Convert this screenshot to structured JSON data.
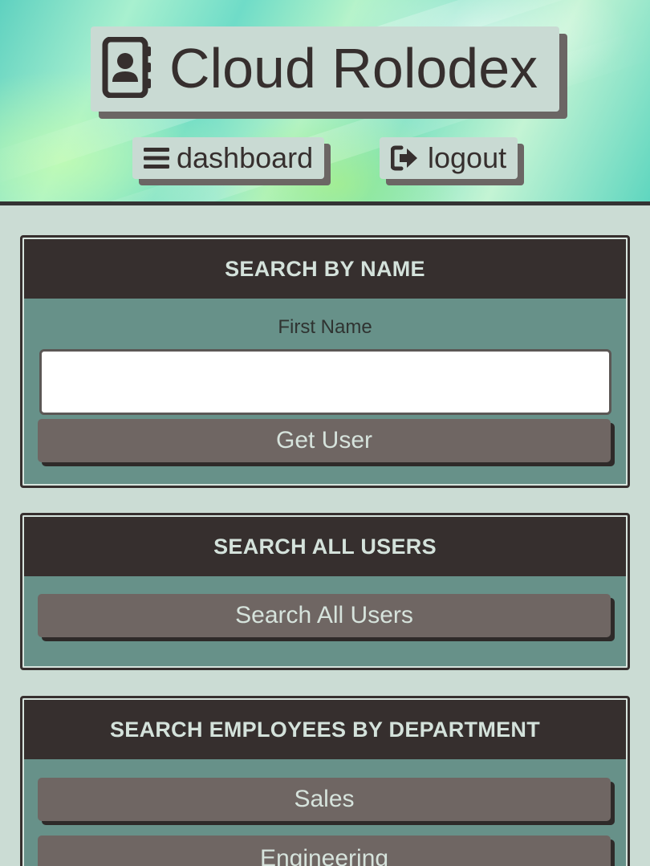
{
  "header": {
    "title": "Cloud Rolodex",
    "nav": {
      "dashboard_label": "dashboard",
      "logout_label": "logout"
    }
  },
  "search_by_name": {
    "heading": "SEARCH BY NAME",
    "field_label": "First Name",
    "field_value": "",
    "button_label": "Get User"
  },
  "search_all": {
    "heading": "SEARCH ALL USERS",
    "button_label": "Search All Users"
  },
  "search_department": {
    "heading": "SEARCH EMPLOYEES BY DEPARTMENT",
    "departments": [
      "Sales",
      "Engineering"
    ]
  },
  "colors": {
    "background": "#cbdcd4",
    "panel_head": "#362f2e",
    "panel_body": "#679189",
    "button": "#6f6663",
    "text_light": "#d6e3dc"
  },
  "icons": {
    "title": "address-book-icon",
    "dashboard": "bars-icon",
    "logout": "sign-out-icon"
  }
}
